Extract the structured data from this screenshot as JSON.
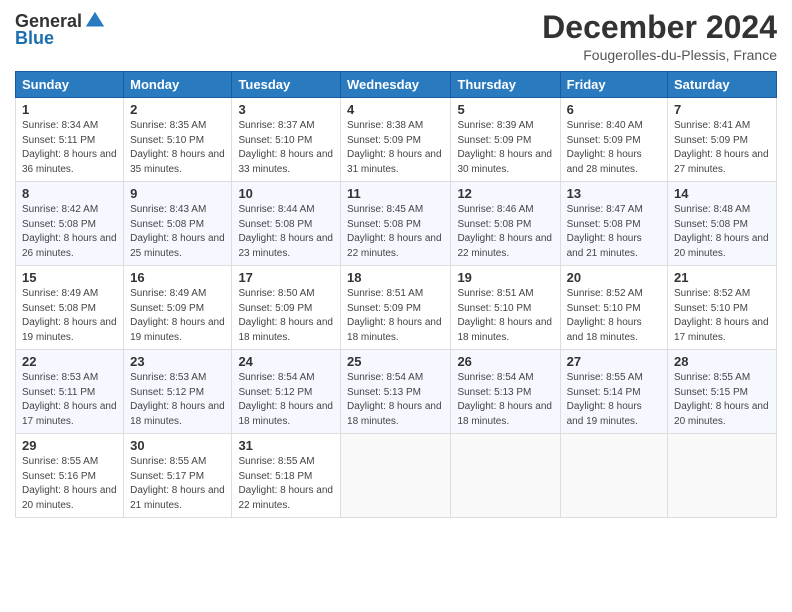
{
  "header": {
    "logo_general": "General",
    "logo_blue": "Blue",
    "month_title": "December 2024",
    "location": "Fougerolles-du-Plessis, France"
  },
  "days_of_week": [
    "Sunday",
    "Monday",
    "Tuesday",
    "Wednesday",
    "Thursday",
    "Friday",
    "Saturday"
  ],
  "weeks": [
    [
      {
        "day": "1",
        "sunrise": "8:34 AM",
        "sunset": "5:11 PM",
        "daylight": "8 hours and 36 minutes."
      },
      {
        "day": "2",
        "sunrise": "8:35 AM",
        "sunset": "5:10 PM",
        "daylight": "8 hours and 35 minutes."
      },
      {
        "day": "3",
        "sunrise": "8:37 AM",
        "sunset": "5:10 PM",
        "daylight": "8 hours and 33 minutes."
      },
      {
        "day": "4",
        "sunrise": "8:38 AM",
        "sunset": "5:09 PM",
        "daylight": "8 hours and 31 minutes."
      },
      {
        "day": "5",
        "sunrise": "8:39 AM",
        "sunset": "5:09 PM",
        "daylight": "8 hours and 30 minutes."
      },
      {
        "day": "6",
        "sunrise": "8:40 AM",
        "sunset": "5:09 PM",
        "daylight": "8 hours and 28 minutes."
      },
      {
        "day": "7",
        "sunrise": "8:41 AM",
        "sunset": "5:09 PM",
        "daylight": "8 hours and 27 minutes."
      }
    ],
    [
      {
        "day": "8",
        "sunrise": "8:42 AM",
        "sunset": "5:08 PM",
        "daylight": "8 hours and 26 minutes."
      },
      {
        "day": "9",
        "sunrise": "8:43 AM",
        "sunset": "5:08 PM",
        "daylight": "8 hours and 25 minutes."
      },
      {
        "day": "10",
        "sunrise": "8:44 AM",
        "sunset": "5:08 PM",
        "daylight": "8 hours and 23 minutes."
      },
      {
        "day": "11",
        "sunrise": "8:45 AM",
        "sunset": "5:08 PM",
        "daylight": "8 hours and 22 minutes."
      },
      {
        "day": "12",
        "sunrise": "8:46 AM",
        "sunset": "5:08 PM",
        "daylight": "8 hours and 22 minutes."
      },
      {
        "day": "13",
        "sunrise": "8:47 AM",
        "sunset": "5:08 PM",
        "daylight": "8 hours and 21 minutes."
      },
      {
        "day": "14",
        "sunrise": "8:48 AM",
        "sunset": "5:08 PM",
        "daylight": "8 hours and 20 minutes."
      }
    ],
    [
      {
        "day": "15",
        "sunrise": "8:49 AM",
        "sunset": "5:08 PM",
        "daylight": "8 hours and 19 minutes."
      },
      {
        "day": "16",
        "sunrise": "8:49 AM",
        "sunset": "5:09 PM",
        "daylight": "8 hours and 19 minutes."
      },
      {
        "day": "17",
        "sunrise": "8:50 AM",
        "sunset": "5:09 PM",
        "daylight": "8 hours and 18 minutes."
      },
      {
        "day": "18",
        "sunrise": "8:51 AM",
        "sunset": "5:09 PM",
        "daylight": "8 hours and 18 minutes."
      },
      {
        "day": "19",
        "sunrise": "8:51 AM",
        "sunset": "5:10 PM",
        "daylight": "8 hours and 18 minutes."
      },
      {
        "day": "20",
        "sunrise": "8:52 AM",
        "sunset": "5:10 PM",
        "daylight": "8 hours and 18 minutes."
      },
      {
        "day": "21",
        "sunrise": "8:52 AM",
        "sunset": "5:10 PM",
        "daylight": "8 hours and 17 minutes."
      }
    ],
    [
      {
        "day": "22",
        "sunrise": "8:53 AM",
        "sunset": "5:11 PM",
        "daylight": "8 hours and 17 minutes."
      },
      {
        "day": "23",
        "sunrise": "8:53 AM",
        "sunset": "5:12 PM",
        "daylight": "8 hours and 18 minutes."
      },
      {
        "day": "24",
        "sunrise": "8:54 AM",
        "sunset": "5:12 PM",
        "daylight": "8 hours and 18 minutes."
      },
      {
        "day": "25",
        "sunrise": "8:54 AM",
        "sunset": "5:13 PM",
        "daylight": "8 hours and 18 minutes."
      },
      {
        "day": "26",
        "sunrise": "8:54 AM",
        "sunset": "5:13 PM",
        "daylight": "8 hours and 18 minutes."
      },
      {
        "day": "27",
        "sunrise": "8:55 AM",
        "sunset": "5:14 PM",
        "daylight": "8 hours and 19 minutes."
      },
      {
        "day": "28",
        "sunrise": "8:55 AM",
        "sunset": "5:15 PM",
        "daylight": "8 hours and 20 minutes."
      }
    ],
    [
      {
        "day": "29",
        "sunrise": "8:55 AM",
        "sunset": "5:16 PM",
        "daylight": "8 hours and 20 minutes."
      },
      {
        "day": "30",
        "sunrise": "8:55 AM",
        "sunset": "5:17 PM",
        "daylight": "8 hours and 21 minutes."
      },
      {
        "day": "31",
        "sunrise": "8:55 AM",
        "sunset": "5:18 PM",
        "daylight": "8 hours and 22 minutes."
      },
      null,
      null,
      null,
      null
    ]
  ],
  "labels": {
    "sunrise": "Sunrise:",
    "sunset": "Sunset:",
    "daylight": "Daylight:"
  }
}
